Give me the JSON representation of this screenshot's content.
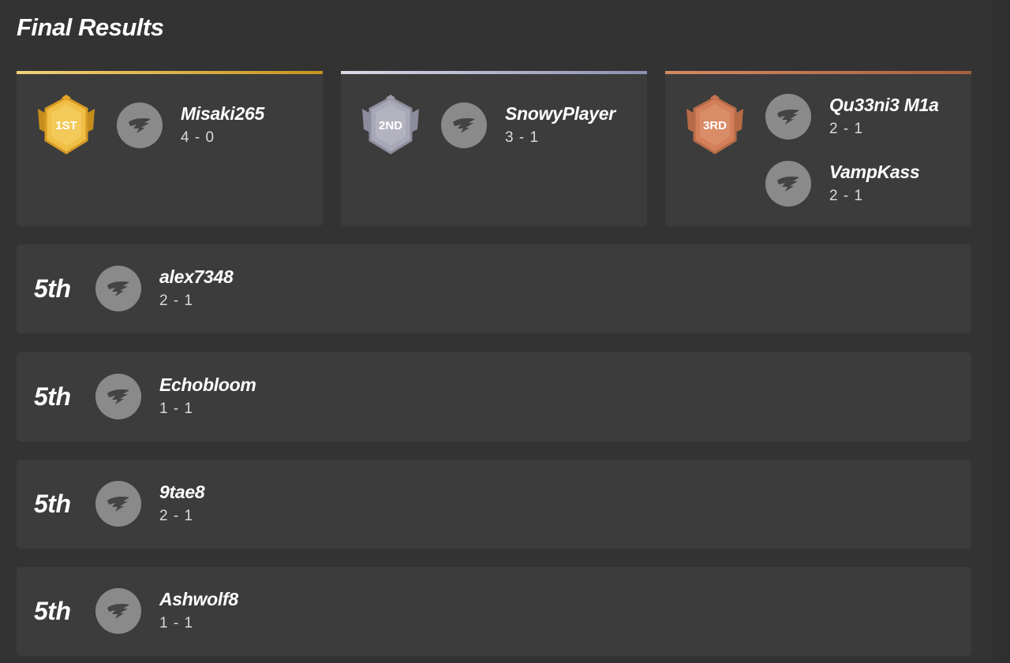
{
  "page": {
    "title": "Final Results"
  },
  "podium": [
    {
      "place_badge": "1ST",
      "badge_color": "#e9b43a",
      "bar_color": "#d9a93a",
      "players": [
        {
          "name": "Misaki265",
          "record": "4 - 0"
        }
      ]
    },
    {
      "place_badge": "2ND",
      "badge_color": "#a8a8b8",
      "bar_color": "#9a9ab8",
      "players": [
        {
          "name": "SnowyPlayer",
          "record": "3 - 1"
        }
      ]
    },
    {
      "place_badge": "3RD",
      "badge_color": "#d1805a",
      "bar_color": "#c07a56",
      "players": [
        {
          "name": "Qu33ni3 M1a",
          "record": "2 - 1"
        },
        {
          "name": "VampKass",
          "record": "2 - 1"
        }
      ]
    }
  ],
  "rows": [
    {
      "rank": "5th",
      "name": "alex7348",
      "record": "2 - 1"
    },
    {
      "rank": "5th",
      "name": "Echobloom",
      "record": "1 - 1"
    },
    {
      "rank": "5th",
      "name": "9tae8",
      "record": "2 - 1"
    },
    {
      "rank": "5th",
      "name": "Ashwolf8",
      "record": "1 - 1"
    }
  ],
  "icons": {
    "avatar": "default-avatar-icon",
    "badge": "medal-badge-icon"
  }
}
